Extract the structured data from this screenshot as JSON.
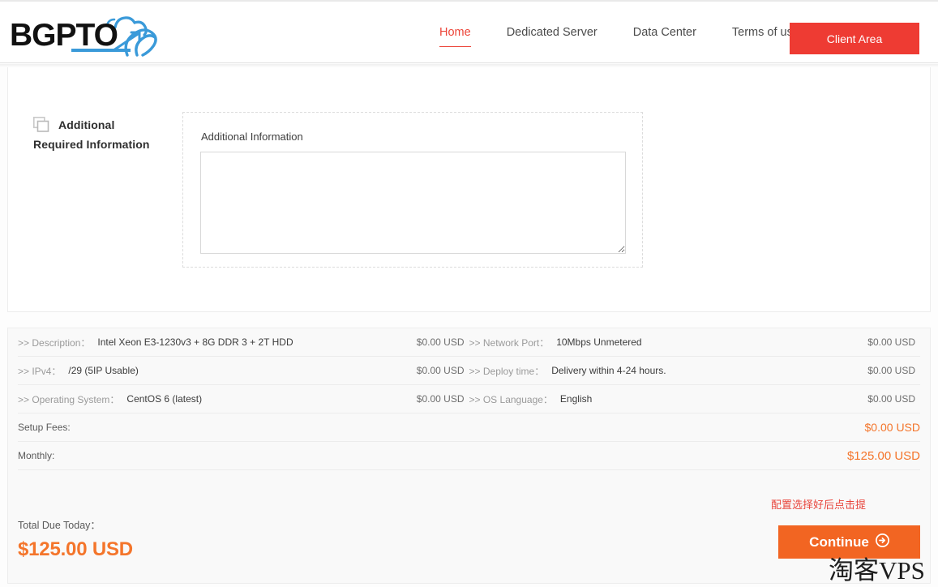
{
  "header": {
    "logo_text": "BGPTO",
    "nav": [
      {
        "label": "Home",
        "active": true
      },
      {
        "label": "Dedicated Server",
        "active": false
      },
      {
        "label": "Data Center",
        "active": false
      },
      {
        "label": "Terms of use",
        "active": false
      }
    ],
    "client_area_label": "Client Area",
    "client_area_color": "#ee3b33",
    "active_nav_color": "#ec4438"
  },
  "additional": {
    "title_line1": "Additional",
    "title_line2": "Required Information",
    "field_label": "Additional Information",
    "textarea_value": "",
    "textarea_placeholder": ""
  },
  "summary": {
    "rows": [
      {
        "left_key": ">> Description：",
        "left_value": "Intel Xeon E3-1230v3 + 8G DDR 3 + 2T HDD",
        "left_price": "$0.00 USD",
        "right_key": ">> Network Port：",
        "right_value": "10Mbps Unmetered",
        "right_price": "$0.00 USD"
      },
      {
        "left_key": ">> IPv4：",
        "left_value": "/29 (5IP Usable)",
        "left_price": "$0.00 USD",
        "right_key": ">> Deploy time：",
        "right_value": "Delivery within 4-24 hours.",
        "right_price": "$0.00 USD"
      },
      {
        "left_key": ">> Operating System：",
        "left_value": "CentOS 6 (latest)",
        "left_price": "$0.00 USD",
        "right_key": ">> OS Language：",
        "right_value": "English",
        "right_price": "$0.00 USD"
      }
    ],
    "fees": [
      {
        "label": "Setup Fees:",
        "value": "$0.00 USD"
      },
      {
        "label": "Monthly:",
        "value": "$125.00 USD"
      }
    ],
    "total_label": "Total Due Today：",
    "total_value": "$125.00 USD",
    "total_color": "#f4752b",
    "annotation": "配置选择好后点击提",
    "annotation_color": "#e8453c",
    "continue_label": "Continue",
    "continue_color": "#f26522"
  },
  "watermark": {
    "text": "淘客VPS"
  },
  "icons": {
    "layers": "layers-icon",
    "arrow_circle": "arrow-circle-right-icon"
  }
}
